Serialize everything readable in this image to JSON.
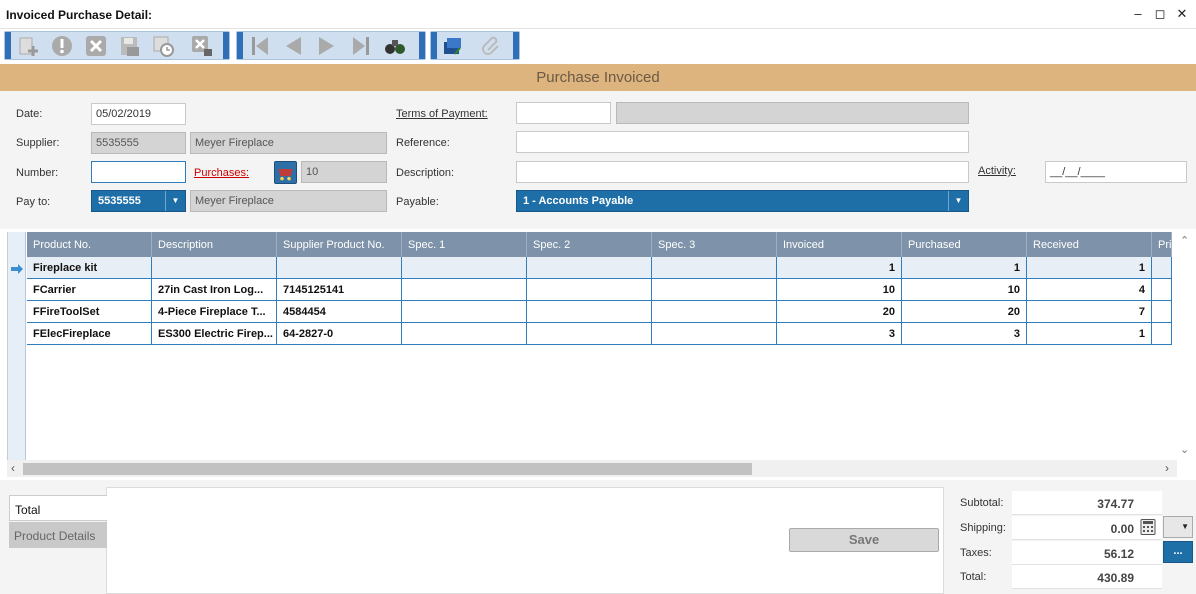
{
  "window": {
    "title": "Invoiced Purchase Detail:"
  },
  "toolbar": {
    "buttons": [
      "new-icon",
      "alert-icon",
      "delete-icon",
      "save-icon",
      "history-icon",
      "cancel-lock-icon"
    ],
    "nav": [
      "first-icon",
      "previous-icon",
      "next-icon",
      "last-icon",
      "binoculars-icon"
    ],
    "extra": [
      "print-stack-icon",
      "attachment-icon"
    ]
  },
  "banner": {
    "text": "Purchase Invoiced"
  },
  "form": {
    "date_label": "Date:",
    "date_value": "05/02/2019",
    "supplier_label": "Supplier:",
    "supplier_code": "5535555",
    "supplier_name": "Meyer Fireplace",
    "number_label": "Number:",
    "number_value": "",
    "purchases_label": "Purchases:",
    "purchases_value": "10",
    "payto_label": "Pay to:",
    "payto_code": "5535555",
    "payto_name": "Meyer Fireplace",
    "terms_label": "Terms of Payment:",
    "terms_value": "",
    "terms_desc": "",
    "reference_label": "Reference:",
    "reference_value": "",
    "description_label": "Description:",
    "description_value": "",
    "activity_label": "Activity:",
    "activity_value": "__/__/____",
    "payable_label": "Payable:",
    "payable_value": "1 - Accounts Payable"
  },
  "grid": {
    "columns": [
      "Product No.",
      "Description",
      "Supplier Product No.",
      "Spec. 1",
      "Spec. 2",
      "Spec. 3",
      "Invoiced",
      "Purchased",
      "Received",
      "Price"
    ],
    "rows": [
      {
        "product": "Fireplace kit",
        "description": "",
        "supplier_no": "",
        "spec1": "",
        "spec2": "",
        "spec3": "",
        "invoiced": "1",
        "purchased": "1",
        "received": "1",
        "price": ""
      },
      {
        "product": "FCarrier",
        "description": "27in Cast Iron Log...",
        "supplier_no": "7145125141",
        "spec1": "",
        "spec2": "",
        "spec3": "",
        "invoiced": "10",
        "purchased": "10",
        "received": "4",
        "price": ""
      },
      {
        "product": "FFireToolSet",
        "description": "4-Piece Fireplace T...",
        "supplier_no": "4584454",
        "spec1": "",
        "spec2": "",
        "spec3": "",
        "invoiced": "20",
        "purchased": "20",
        "received": "7",
        "price": ""
      },
      {
        "product": "FElecFireplace",
        "description": "ES300 Electric Firep...",
        "supplier_no": "64-2827-0",
        "spec1": "",
        "spec2": "",
        "spec3": "",
        "invoiced": "3",
        "purchased": "3",
        "received": "1",
        "price": ""
      }
    ]
  },
  "tabs": {
    "total": "Total",
    "product_details": "Product Details"
  },
  "save_label": "Save",
  "totals": {
    "subtotal_label": "Subtotal:",
    "subtotal_value": "374.77",
    "shipping_label": "Shipping:",
    "shipping_value": "0.00",
    "taxes_label": "Taxes:",
    "taxes_value": "56.12",
    "total_label": "Total:",
    "total_value": "430.89",
    "taxes_button": "..."
  },
  "colors": {
    "banner": "#ddb37e",
    "accent": "#1e6ea8",
    "grid_header": "#7e93a9"
  }
}
